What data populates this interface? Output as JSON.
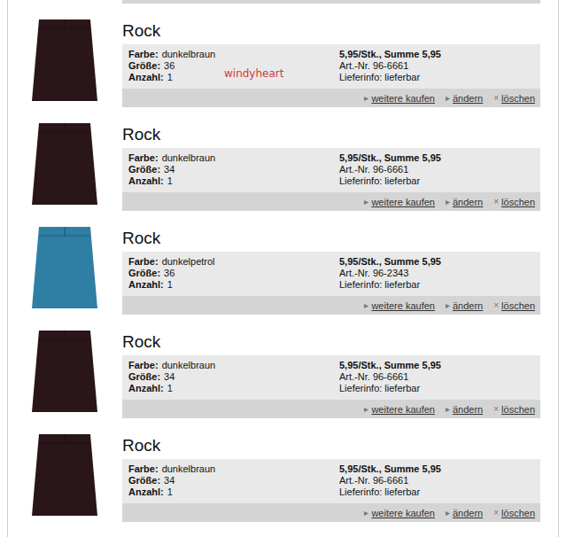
{
  "labels": {
    "color": "Farbe:",
    "size": "Größe:",
    "quantity": "Anzahl:"
  },
  "watermark": {
    "text": "windyheart"
  },
  "actions": [
    {
      "icon": "▸",
      "label": "weitere kaufen"
    },
    {
      "icon": "▸",
      "label": "ändern"
    },
    {
      "icon": "×",
      "label": "löschen"
    }
  ],
  "items": [
    {
      "title": "Rock",
      "color_name": "dunkelbraun",
      "size": "36",
      "quantity": "1",
      "price": "5,95/Stk., Summe 5,95",
      "article": "Art.-Nr. 96-6661",
      "delivery": "Lieferinfo: lieferbar",
      "color": "#2a1619"
    },
    {
      "title": "Rock",
      "color_name": "dunkelbraun",
      "size": "34",
      "quantity": "1",
      "price": "5,95/Stk., Summe 5,95",
      "article": "Art.-Nr. 96-6661",
      "delivery": "Lieferinfo: lieferbar",
      "color": "#2a1619"
    },
    {
      "title": "Rock",
      "color_name": "dunkelpetrol",
      "size": "36",
      "quantity": "1",
      "price": "5,95/Stk., Summe 5,95",
      "article": "Art.-Nr. 96-2343",
      "delivery": "Lieferinfo: lieferbar",
      "color": "#2f7ea3"
    },
    {
      "title": "Rock",
      "color_name": "dunkelbraun",
      "size": "34",
      "quantity": "1",
      "price": "5,95/Stk., Summe 5,95",
      "article": "Art.-Nr. 96-6661",
      "delivery": "Lieferinfo: lieferbar",
      "color": "#2a1619"
    },
    {
      "title": "Rock",
      "color_name": "dunkelbraun",
      "size": "34",
      "quantity": "1",
      "price": "5,95/Stk., Summe 5,95",
      "article": "Art.-Nr. 96-6661",
      "delivery": "Lieferinfo: lieferbar",
      "color": "#2a1619"
    }
  ]
}
